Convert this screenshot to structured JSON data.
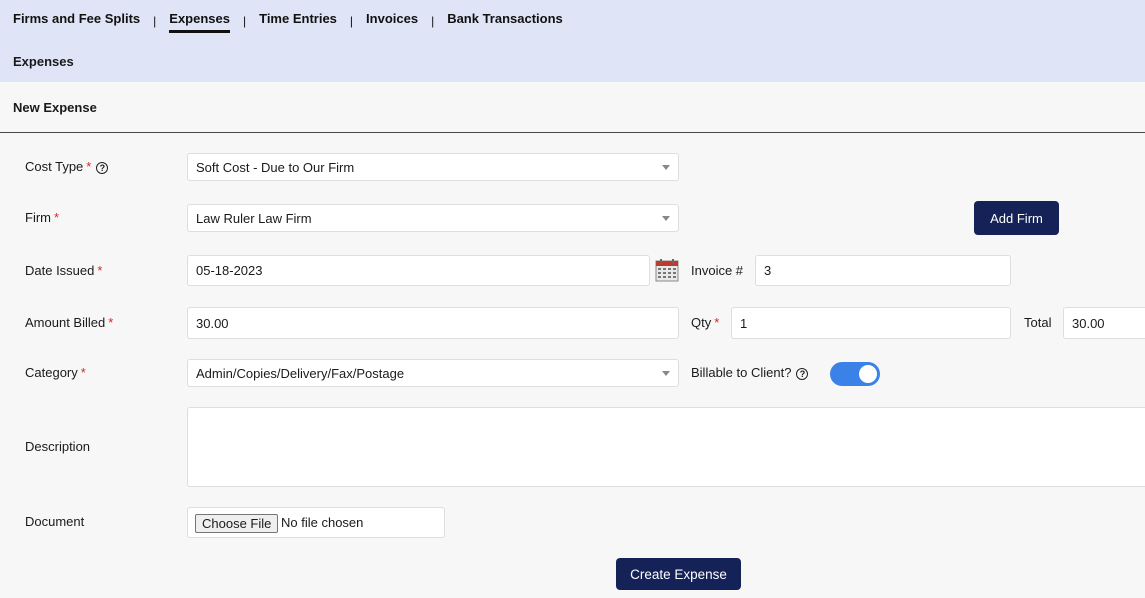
{
  "nav": {
    "tabs": [
      "Firms and Fee Splits",
      "Expenses",
      "Time Entries",
      "Invoices",
      "Bank Transactions"
    ],
    "separator": "|",
    "active_tab": "Expenses"
  },
  "page_title": "Expenses",
  "form_title": "New Expense",
  "required_mark": "*",
  "help_glyph": "?",
  "form": {
    "cost_type": {
      "label": "Cost Type",
      "value": "Soft Cost - Due to Our Firm"
    },
    "firm": {
      "label": "Firm",
      "value": "Law Ruler Law Firm"
    },
    "add_firm": "Add Firm",
    "date_issued": {
      "label": "Date Issued",
      "value": "05-18-2023"
    },
    "invoice": {
      "label": "Invoice #",
      "value": "3"
    },
    "amount_billed": {
      "label": "Amount Billed",
      "value": "30.00"
    },
    "qty": {
      "label": "Qty",
      "value": "1"
    },
    "total": {
      "label": "Total",
      "value": "30.00"
    },
    "category": {
      "label": "Category",
      "value": "Admin/Copies/Delivery/Fax/Postage"
    },
    "billable": {
      "label": "Billable to Client?",
      "checked": true
    },
    "description": {
      "label": "Description",
      "value": ""
    },
    "document": {
      "label": "Document",
      "button": "Choose File",
      "status": "No file chosen"
    },
    "submit": "Create Expense"
  },
  "colors": {
    "header_bg": "#dfe5f6",
    "primary_button": "#142257",
    "toggle_on": "#3b82e8",
    "required": "#d6242d"
  }
}
